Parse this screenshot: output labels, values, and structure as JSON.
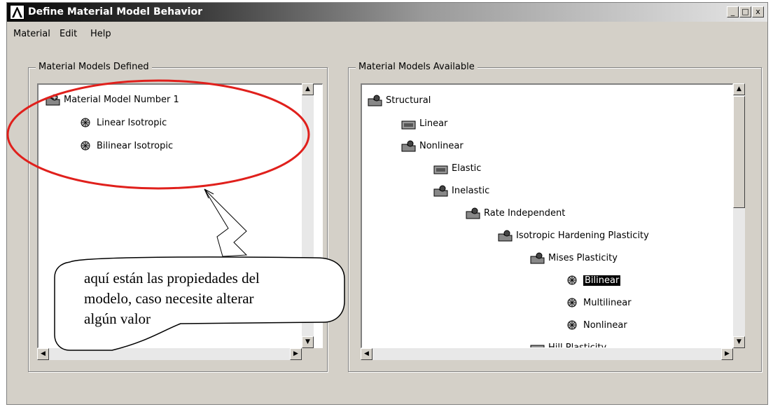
{
  "window": {
    "title": "Define Material Model Behavior",
    "controls": [
      "_",
      "□",
      "x"
    ]
  },
  "menu": [
    "Material",
    "Edit",
    "Help"
  ],
  "left_panel": {
    "label": "Material Models Defined",
    "items": [
      {
        "label": "Material Model Number 1",
        "icon": "material-folder-icon"
      },
      {
        "label": "Linear Isotropic",
        "icon": "model-sphere-icon"
      },
      {
        "label": "Bilinear Isotropic",
        "icon": "model-sphere-icon"
      }
    ]
  },
  "right_panel": {
    "label": "Material Models Available",
    "items": [
      {
        "label": "Structural",
        "icon": "folder-open-icon"
      },
      {
        "label": "Linear",
        "icon": "folder-closed-icon"
      },
      {
        "label": "Nonlinear",
        "icon": "folder-open-icon"
      },
      {
        "label": "Elastic",
        "icon": "folder-closed-icon"
      },
      {
        "label": "Inelastic",
        "icon": "folder-open-icon"
      },
      {
        "label": "Rate Independent",
        "icon": "folder-open-icon"
      },
      {
        "label": "Isotropic Hardening Plasticity",
        "icon": "folder-open-icon"
      },
      {
        "label": "Mises Plasticity",
        "icon": "folder-open-icon"
      },
      {
        "label": "Bilinear",
        "icon": "model-sphere-icon",
        "selected": true
      },
      {
        "label": "Multilinear",
        "icon": "model-sphere-icon"
      },
      {
        "label": "Nonlinear",
        "icon": "model-sphere-icon"
      },
      {
        "label": "Hill Plasticity",
        "icon": "folder-closed-icon"
      }
    ]
  },
  "annotation": {
    "lines": [
      "aquí están las propiedades del",
      "modelo, caso necesite alterar",
      "algún valor"
    ],
    "ellipse_color": "#e0201c"
  }
}
